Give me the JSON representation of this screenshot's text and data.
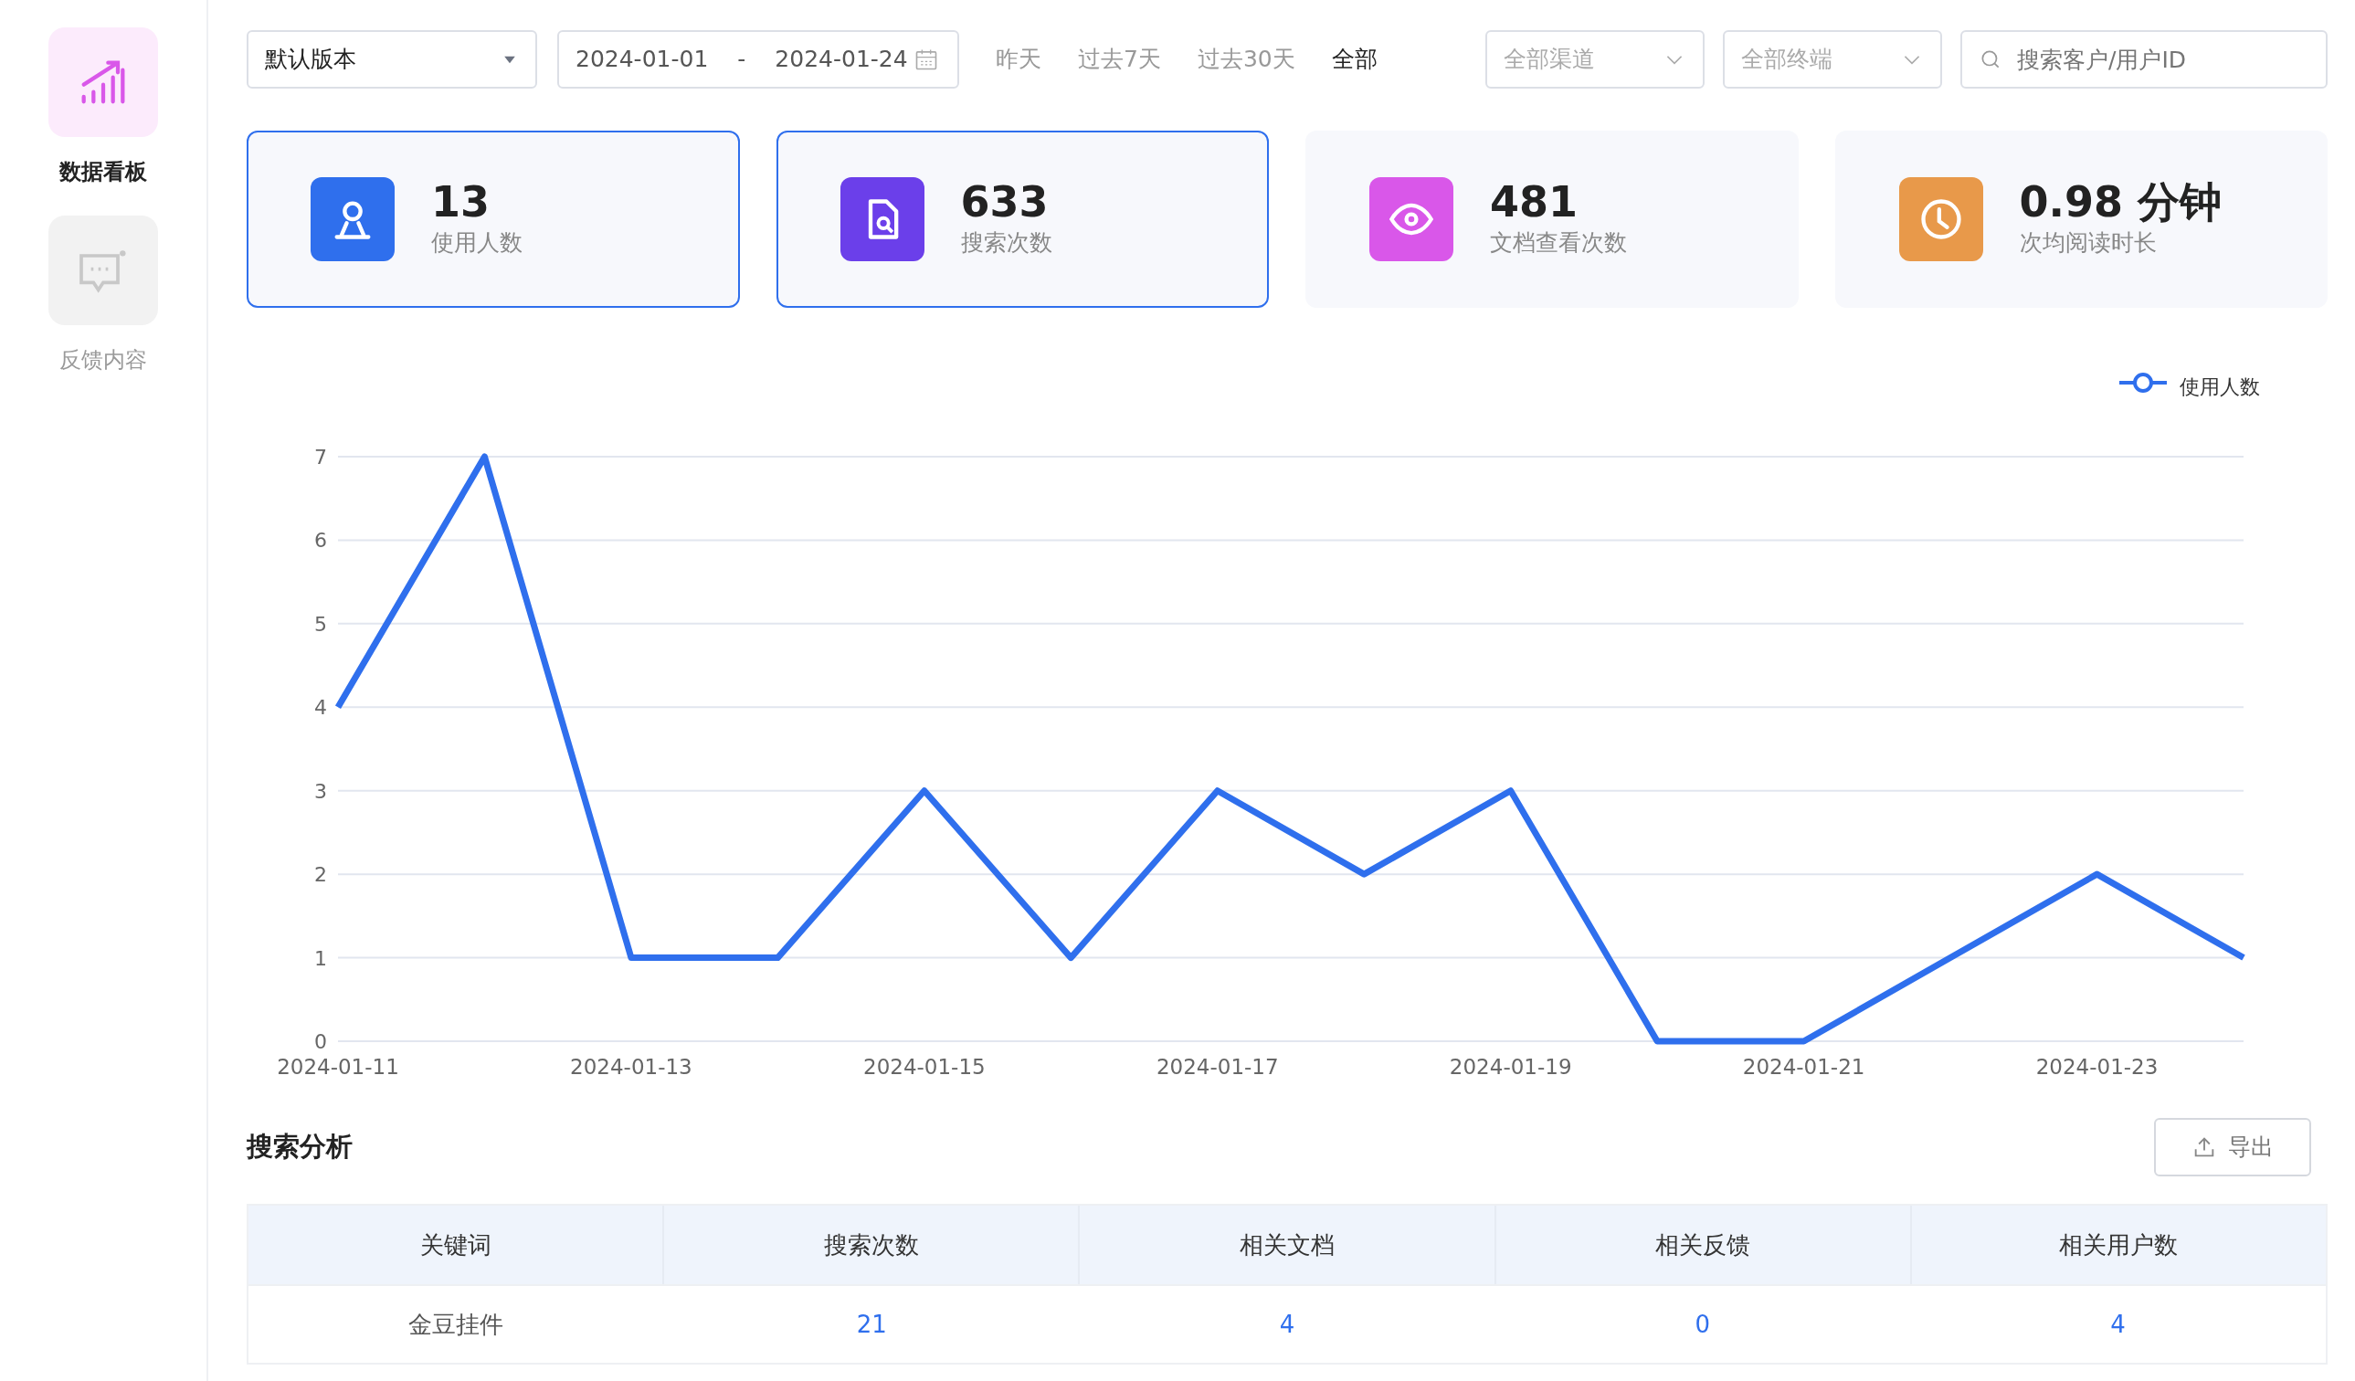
{
  "sidebar": {
    "items": [
      {
        "label": "数据看板",
        "kind": "chart",
        "selected": true
      },
      {
        "label": "反馈内容",
        "kind": "message",
        "selected": false
      }
    ]
  },
  "toolbar": {
    "version_select": "默认版本",
    "date_range": {
      "start": "2024-01-01",
      "separator": "-",
      "end": "2024-01-24"
    },
    "presets": [
      {
        "label": "昨天",
        "selected": false
      },
      {
        "label": "过去7天",
        "selected": false
      },
      {
        "label": "过去30天",
        "selected": false
      },
      {
        "label": "全部",
        "selected": true
      }
    ],
    "dropdowns": [
      {
        "placeholder": "全部渠道"
      },
      {
        "placeholder": "全部终端"
      }
    ],
    "search": {
      "placeholder": "搜索客户/用户ID"
    }
  },
  "stats": [
    {
      "kind": "user",
      "value": "13",
      "label": "使用人数",
      "color": "#2f6fed",
      "selected": true
    },
    {
      "kind": "search",
      "value": "633",
      "label": "搜索次数",
      "color": "#6b3fea",
      "selected": true
    },
    {
      "kind": "view",
      "value": "481",
      "label": "文档查看次数",
      "color": "#d957e9",
      "selected": false
    },
    {
      "kind": "time",
      "value": "0.98 分钟",
      "label": "次均阅读时长",
      "color": "#e8994a",
      "selected": false
    }
  ],
  "chart": {
    "chart_data": {
      "type": "line",
      "categories": [
        "2024-01-11",
        null,
        "2024-01-13",
        null,
        "2024-01-15",
        null,
        "2024-01-17",
        null,
        "2024-01-19",
        null,
        "2024-01-21",
        null,
        "2024-01-23",
        null
      ],
      "series": [
        {
          "name": "使用人数",
          "color": "#2f6fed",
          "values": [
            4,
            7,
            1,
            1,
            3,
            1,
            3,
            2,
            3,
            0,
            0,
            1,
            2,
            1
          ]
        }
      ],
      "ylim": [
        0,
        7
      ],
      "yticks": [
        0,
        1,
        2,
        3,
        4,
        5,
        6,
        7
      ],
      "grid": true
    }
  },
  "search_analysis": {
    "title": "搜索分析",
    "export_button": "导出",
    "table": {
      "columns": [
        "关键词",
        "搜索次数",
        "相关文档",
        "相关反馈",
        "相关用户数"
      ],
      "rows": [
        [
          "金豆挂件",
          "21",
          "4",
          "0",
          "4"
        ]
      ]
    }
  }
}
